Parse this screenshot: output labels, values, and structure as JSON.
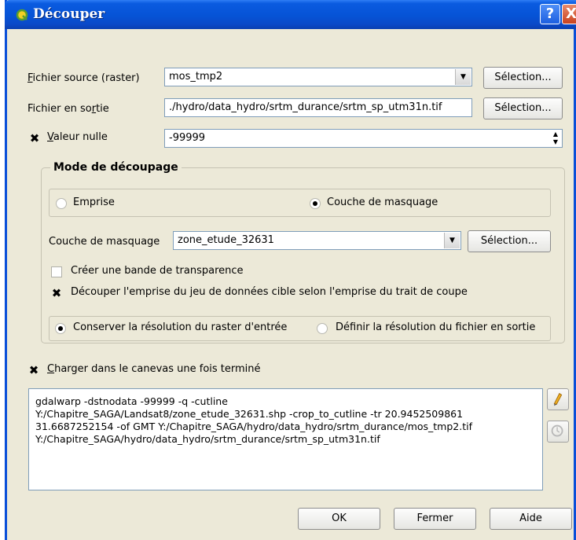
{
  "window": {
    "title": "Découper"
  },
  "titlebar": {
    "help_label": "?",
    "close_label": "X"
  },
  "source": {
    "label_first": "F",
    "label_rest": "ichier source (raster)",
    "value": "mos_tmp2",
    "button": "Sélection..."
  },
  "output": {
    "label_pre": "Fichier en so",
    "label_u": "r",
    "label_post": "tie",
    "value": "./hydro/data_hydro/srtm_durance/srtm_sp_utm31n.tif",
    "button": "Sélection..."
  },
  "nodata": {
    "checked": true,
    "label_first": "V",
    "label_rest": "aleur nulle",
    "value": "-99999"
  },
  "mode": {
    "title": "Mode de découpage",
    "extent_label": "Emprise",
    "mask_layer_label": "Couche de masquage",
    "selected": "mask"
  },
  "mask": {
    "label": "Couche de masquage",
    "value": "zone_etude_32631",
    "button": "Sélection..."
  },
  "options": {
    "alpha_band": {
      "label": "Créer une bande de transparence",
      "checked": false
    },
    "crop_to_cutline": {
      "label": "Découper l'emprise du jeu de données cible selon l'emprise du trait de coupe",
      "checked": true
    }
  },
  "resolution": {
    "keep_label": "Conserver la résolution du raster d'entrée",
    "set_label": "Définir la résolution du fichier en sortie",
    "selected": "keep"
  },
  "load_canvas": {
    "checked": true,
    "label_first": "C",
    "label_rest": "harger dans le canevas une fois terminé"
  },
  "command": {
    "text": "gdalwarp -dstnodata -99999 -q -cutline\nY:/Chapitre_SAGA/Landsat8/zone_etude_32631.shp -crop_to_cutline -tr 20.9452509861\n31.6687252154 -of GMT Y:/Chapitre_SAGA/hydro/data_hydro/srtm_durance/mos_tmp2.tif\nY:/Chapitre_SAGA/hydro/data_hydro/srtm_durance/srtm_sp_utm31n.tif"
  },
  "buttons": {
    "ok": "OK",
    "close": "Fermer",
    "help": "Aide"
  },
  "icons": {
    "app": "qgis-logo-icon",
    "edit": "pencil-edit-icon",
    "reset": "reset-icon"
  },
  "colors": {
    "titlebar": "#0653d6",
    "window_bg": "#ece9d8",
    "field_border": "#7f9db9"
  }
}
